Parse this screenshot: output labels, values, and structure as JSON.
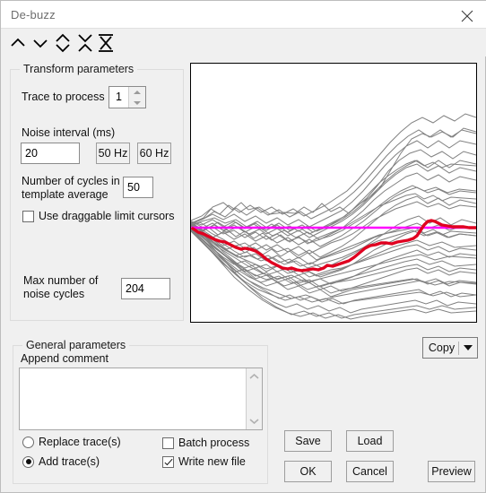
{
  "window": {
    "title": "De-buzz",
    "close_icon": "close-icon"
  },
  "toolbar": {
    "items": [
      {
        "name": "move-up-icon",
        "glyph": "chevron-up"
      },
      {
        "name": "move-down-icon",
        "glyph": "chevron-down"
      },
      {
        "name": "expand-vertical-icon",
        "glyph": "diamond"
      },
      {
        "name": "collapse-vertical-icon",
        "glyph": "x-collapse"
      },
      {
        "name": "fit-vertical-icon",
        "glyph": "fit-bars"
      }
    ]
  },
  "transform": {
    "group_title": "Transform parameters",
    "trace_label": "Trace to process",
    "trace_value": "1",
    "noise_interval_label": "Noise interval (ms)",
    "noise_interval_value": "20",
    "hz50_label": "50 Hz",
    "hz60_label": "60 Hz",
    "cycles_label": "Number of cycles in\ntemplate average",
    "cycles_value": "50",
    "draggable_label": "Use draggable limit cursors",
    "draggable_checked": false,
    "max_noise_label": "Max number of\nnoise cycles",
    "max_noise_value": "204"
  },
  "general": {
    "group_title": "General parameters",
    "append_comment_label": "Append comment",
    "comment_value": "",
    "comment_placeholder": "",
    "replace_label": "Replace trace(s)",
    "replace_selected": false,
    "add_label": "Add trace(s)",
    "add_selected": true,
    "batch_label": "Batch process",
    "batch_checked": false,
    "write_label": "Write new file",
    "write_checked": true
  },
  "actions": {
    "copy_label": "Copy",
    "save_label": "Save",
    "load_label": "Load",
    "ok_label": "OK",
    "cancel_label": "Cancel",
    "preview_label": "Preview"
  },
  "colors": {
    "template_line": "#ff00ff",
    "result_trace": "#e00020",
    "raw_traces": "#808080",
    "window_bg": "#f0f0f0",
    "plot_bg": "#ffffff"
  },
  "chart_data": {
    "type": "line",
    "title": "",
    "xlabel": "",
    "ylabel": "",
    "grid": false,
    "legend": null,
    "xlim": [
      0,
      320
    ],
    "ylim": [
      0,
      290
    ],
    "baseline_y": 183,
    "series": [
      {
        "name": "template-baseline",
        "color": "#ff00ff",
        "width": 2.5,
        "points": [
          [
            0,
            183
          ],
          [
            320,
            183
          ]
        ]
      },
      {
        "name": "processed-trace",
        "color": "#e00020",
        "width": 3,
        "points": [
          [
            2,
            184
          ],
          [
            8,
            188
          ],
          [
            14,
            190
          ],
          [
            20,
            193
          ],
          [
            26,
            196
          ],
          [
            32,
            198
          ],
          [
            38,
            199
          ],
          [
            44,
            202
          ],
          [
            50,
            205
          ],
          [
            56,
            207
          ],
          [
            60,
            206
          ],
          [
            66,
            207
          ],
          [
            72,
            209
          ],
          [
            78,
            213
          ],
          [
            84,
            218
          ],
          [
            90,
            222
          ],
          [
            96,
            225
          ],
          [
            102,
            228
          ],
          [
            108,
            229
          ],
          [
            112,
            228
          ],
          [
            118,
            230
          ],
          [
            124,
            231
          ],
          [
            130,
            230
          ],
          [
            136,
            229
          ],
          [
            142,
            230
          ],
          [
            148,
            228
          ],
          [
            152,
            225
          ],
          [
            158,
            226
          ],
          [
            164,
            224
          ],
          [
            170,
            222
          ],
          [
            176,
            220
          ],
          [
            182,
            216
          ],
          [
            188,
            211
          ],
          [
            194,
            206
          ],
          [
            200,
            203
          ],
          [
            206,
            202
          ],
          [
            212,
            200
          ],
          [
            218,
            200
          ],
          [
            224,
            201
          ],
          [
            230,
            199
          ],
          [
            236,
            198
          ],
          [
            242,
            197
          ],
          [
            248,
            195
          ],
          [
            252,
            192
          ],
          [
            256,
            186
          ],
          [
            260,
            180
          ],
          [
            264,
            176
          ],
          [
            268,
            175
          ],
          [
            272,
            176
          ],
          [
            276,
            178
          ],
          [
            280,
            180
          ],
          [
            286,
            181
          ],
          [
            292,
            182
          ],
          [
            298,
            182
          ],
          [
            304,
            182
          ],
          [
            310,
            183
          ],
          [
            316,
            183
          ],
          [
            320,
            183
          ]
        ]
      }
    ],
    "raw_traces_count": 34,
    "description": "Overlaid noisy sweeps fanning out from a narrow left origin; mean drifts downward then recovers to baseline on the right."
  }
}
